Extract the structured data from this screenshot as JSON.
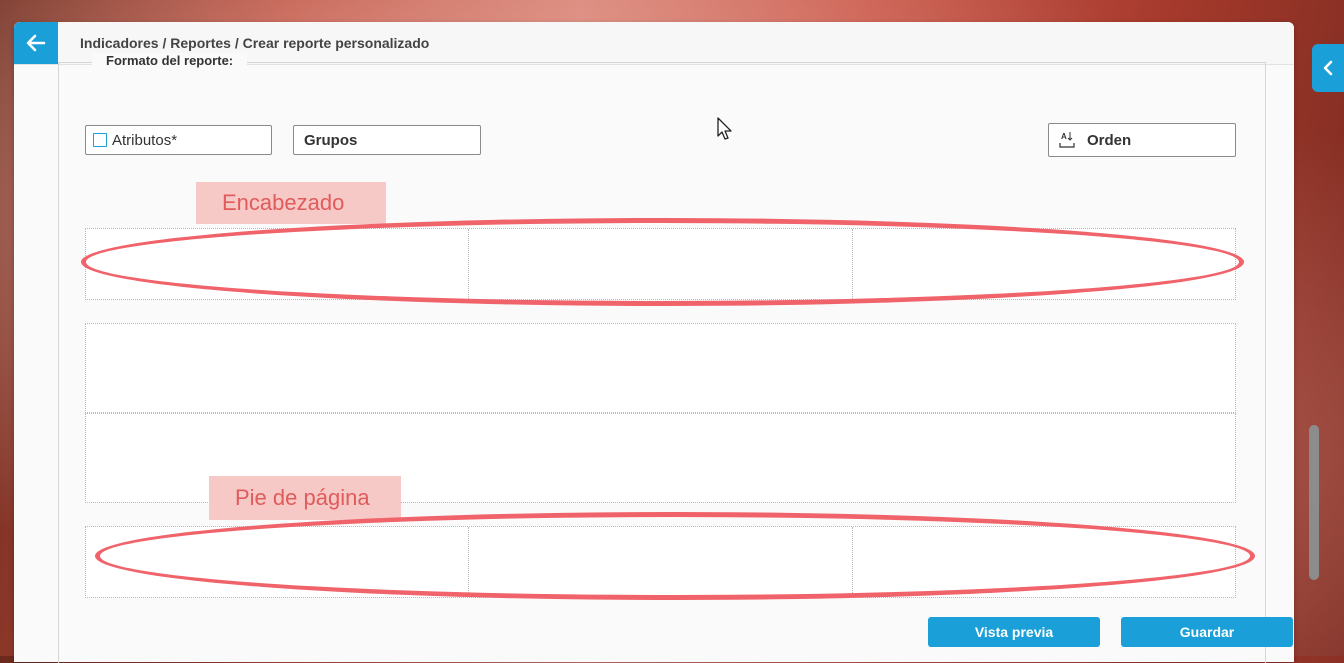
{
  "header": {
    "breadcrumb": "Indicadores / Reportes / Crear reporte personalizado"
  },
  "section": {
    "legend": "Formato del reporte:"
  },
  "fields": {
    "atributos": "Atributos*",
    "grupos": "Grupos",
    "orden": "Orden"
  },
  "annotations": {
    "header_label": "Encabezado",
    "footer_label": "Pie de página"
  },
  "actions": {
    "preview": "Vista previa",
    "save": "Guardar"
  },
  "colors": {
    "accent": "#1a9fd8",
    "annotation": "#f0636a"
  },
  "icons": {
    "back": "arrow-left-icon",
    "sort": "sort-az-icon",
    "checkbox": "checkbox-icon",
    "side": "chevron-left-icon"
  }
}
